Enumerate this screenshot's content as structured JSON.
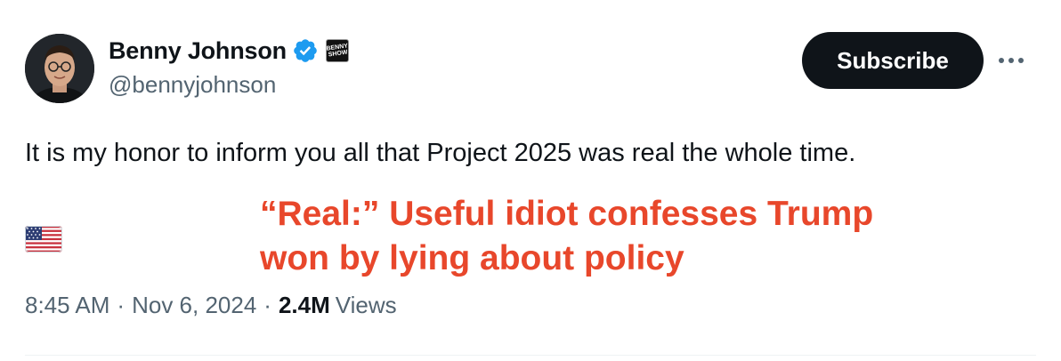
{
  "author": {
    "display_name": "Benny Johnson",
    "handle": "@bennyjohnson",
    "verified": true,
    "affiliate_badge_text": "BENNY SHOW"
  },
  "actions": {
    "subscribe_label": "Subscribe",
    "more_icon": "more-horizontal-icon"
  },
  "tweet": {
    "text": "It is my honor to inform you all that Project 2025 was real the whole time.",
    "flag_icon": "us-flag-icon"
  },
  "overlay": {
    "line1": "“Real:” Useful idiot confesses Trump",
    "line2": "won by lying about policy",
    "color": "#e8472b"
  },
  "meta": {
    "time": "8:45 AM",
    "separator": "·",
    "date": "Nov 6, 2024",
    "views_count": "2.4M",
    "views_label": "Views"
  },
  "colors": {
    "text_primary": "#0f1419",
    "text_secondary": "#536471",
    "verified_blue": "#1d9bf0",
    "button_bg": "#0f1419"
  }
}
